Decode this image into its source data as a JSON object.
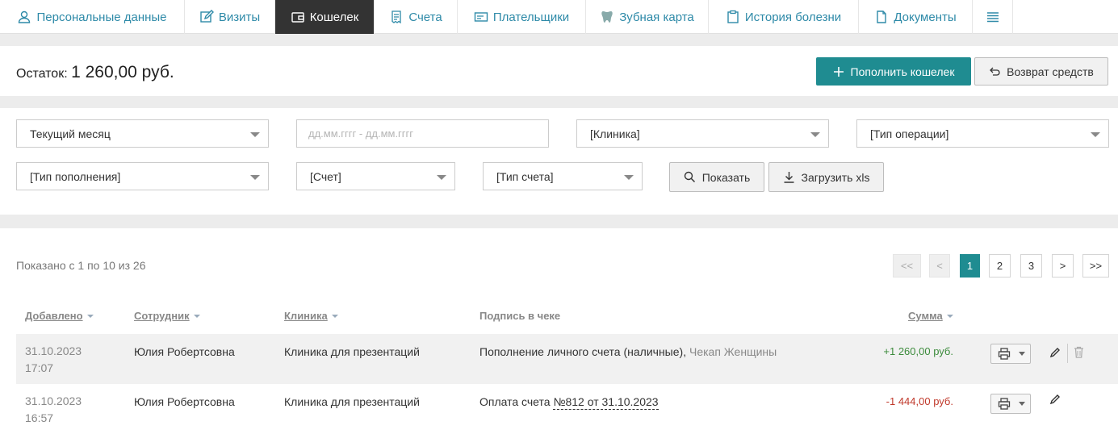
{
  "tabs": [
    {
      "label": "Персональные данные",
      "icon": "user-icon"
    },
    {
      "label": "Визиты",
      "icon": "edit-icon"
    },
    {
      "label": "Кошелек",
      "icon": "wallet-icon",
      "active": true
    },
    {
      "label": "Счета",
      "icon": "receipt-icon"
    },
    {
      "label": "Плательщики",
      "icon": "card-icon"
    },
    {
      "label": "Зубная карта",
      "icon": "tooth-icon"
    },
    {
      "label": "История болезни",
      "icon": "clipboard-icon"
    },
    {
      "label": "Документы",
      "icon": "document-icon"
    },
    {
      "label": "",
      "icon": "menu-icon"
    }
  ],
  "wallet": {
    "balance_label": "Остаток:",
    "balance_value": "1 260,00 руб.",
    "topup_label": "Пополнить кошелек",
    "refund_label": "Возврат средств"
  },
  "filters": {
    "period": "Текущий месяц",
    "date_placeholder": "дд.мм.гггг - дд.мм.гггг",
    "clinic": "[Клиника]",
    "operation_type": "[Тип операции]",
    "topup_type": "[Тип пополнения]",
    "account": "[Счет]",
    "account_type": "[Тип счета]",
    "show_label": "Показать",
    "download_label": "Загрузить xls"
  },
  "pagination": {
    "summary": "Показано с 1 по 10 из 26",
    "first": "<<",
    "prev": "<",
    "pages": [
      "1",
      "2",
      "3"
    ],
    "current": "1",
    "next": ">",
    "last": ">>"
  },
  "table": {
    "headers": {
      "added": "Добавлено",
      "employee": "Сотрудник",
      "clinic": "Клиника",
      "receipt_text": "Подпись в чеке",
      "sum": "Сумма"
    },
    "rows": [
      {
        "date": "31.10.2023",
        "time": "17:07",
        "employee": "Юлия Робертсовна",
        "clinic": "Клиника для презентаций",
        "receipt_main": "Пополнение личного счета (наличные),",
        "receipt_extra": "Чекап Женщины",
        "sum": "+1 260,00 руб."
      },
      {
        "date": "31.10.2023",
        "time": "16:57",
        "employee": "Юлия Робертсовна",
        "clinic": "Клиника для презентаций",
        "receipt_main": "Оплата счета",
        "receipt_link": "№812 от 31.10.2023",
        "sum": "-1 444,00 руб."
      }
    ]
  },
  "colors": {
    "accent": "#1f8c91",
    "link": "#2e8aa8",
    "active_tab": "#333333",
    "positive": "#3c8b3c",
    "negative": "#c0392b"
  }
}
